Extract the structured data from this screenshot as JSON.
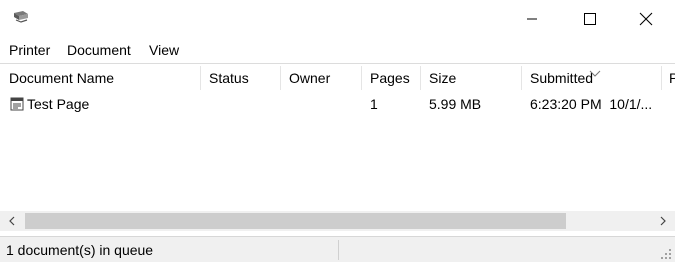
{
  "window": {
    "icon": "printer-icon"
  },
  "menu": {
    "items": [
      "Printer",
      "Document",
      "View"
    ]
  },
  "columns": [
    "Document Name",
    "Status",
    "Owner",
    "Pages",
    "Size",
    "Submitted",
    "P"
  ],
  "sort_column": "Submitted",
  "rows": [
    {
      "document_name": "Test Page",
      "status": "",
      "owner": "",
      "pages": "1",
      "size": "5.99 MB",
      "submitted": "6:23:20 PM  10/1/..."
    }
  ],
  "statusbar": {
    "text": "1 document(s) in queue"
  }
}
